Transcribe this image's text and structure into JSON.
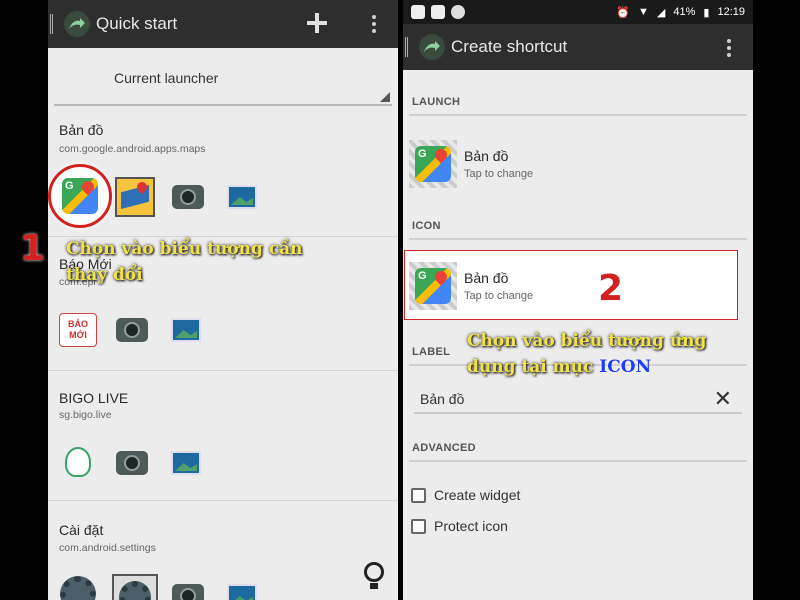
{
  "left_screen": {
    "title": "Quick start",
    "launcher_label": "Current launcher",
    "apps": [
      {
        "name": "Bản đồ",
        "package": "com.google.android.apps.maps"
      },
      {
        "name": "Báo Mới",
        "package": "com.epi"
      },
      {
        "name": "BIGO LIVE",
        "package": "sg.bigo.live"
      },
      {
        "name": "Cài đặt",
        "package": "com.android.settings"
      }
    ],
    "step_number": "1",
    "annotation": "Chọn vào biểu tượng cần thay đổi",
    "baomoi_icon_text": "BÁO MỚI"
  },
  "right_screen": {
    "status": {
      "battery": "41%",
      "time": "12:19"
    },
    "title": "Create shortcut",
    "sections": {
      "launch": "LAUNCH",
      "icon": "ICON",
      "label": "LABEL",
      "advanced": "ADVANCED"
    },
    "launch_item": {
      "name": "Bản đồ",
      "hint": "Tap to change"
    },
    "icon_item": {
      "name": "Bản đồ",
      "hint": "Tap to change"
    },
    "label_value": "Bản đồ",
    "checkboxes": [
      {
        "label": "Create widget",
        "checked": false
      },
      {
        "label": "Protect icon",
        "checked": false
      }
    ],
    "step_number": "2",
    "annotation_line1": "Chọn vào biểu tượng ứng",
    "annotation_line2": "dụng tại mục",
    "annotation_highlight": "ICON"
  },
  "colors": {
    "annotation": "#f1e24c",
    "step": "#d32020",
    "highlight": "#1e3cff"
  }
}
